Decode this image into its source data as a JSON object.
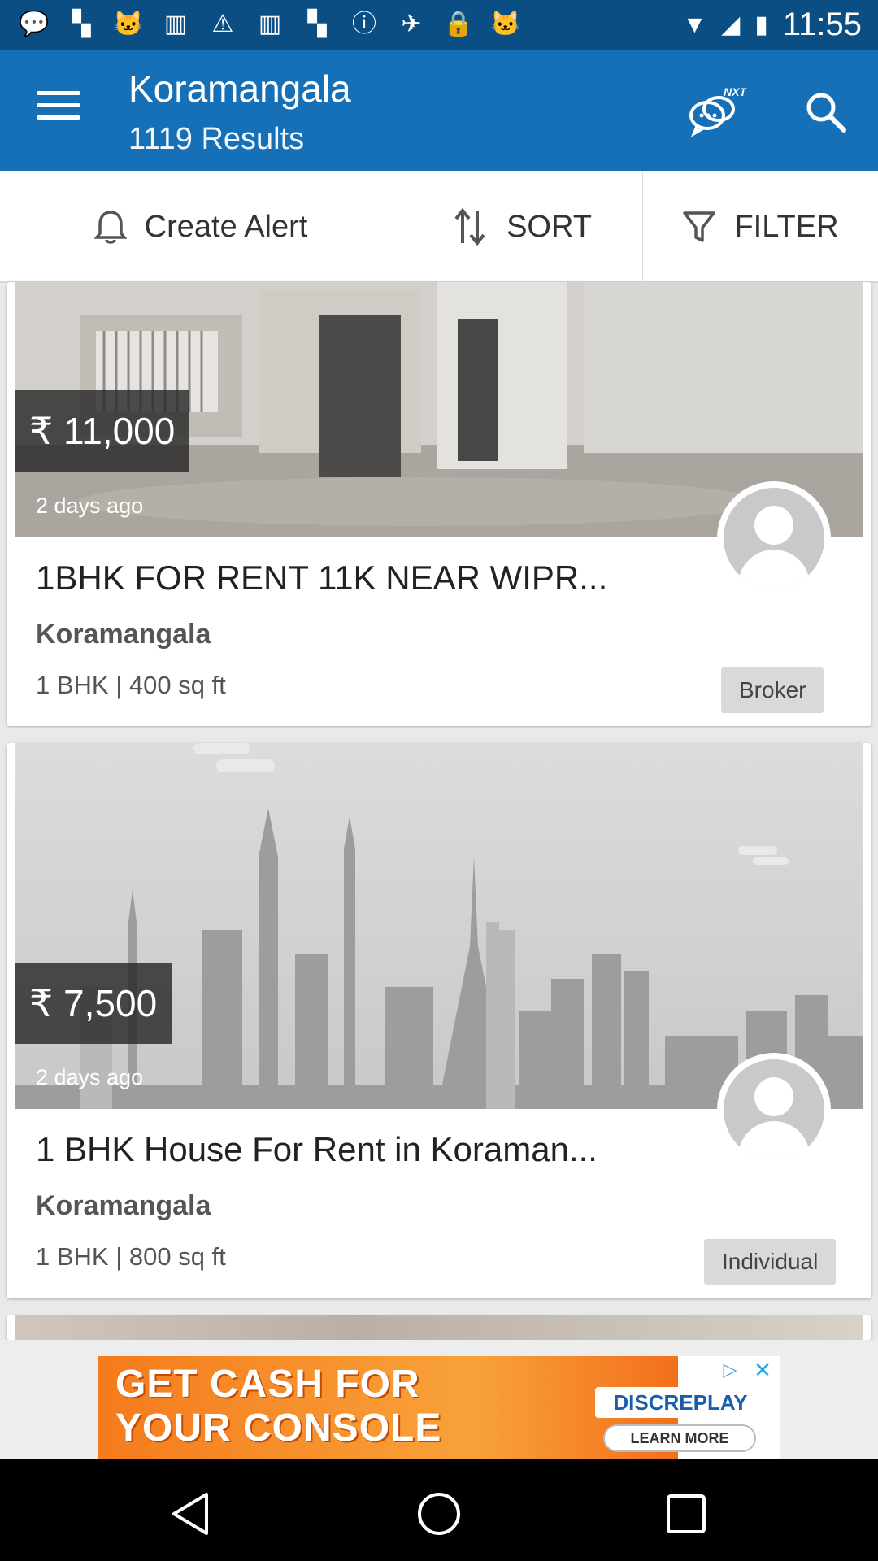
{
  "status_bar": {
    "time": "11:55",
    "icons": [
      "chat-bubble-icon",
      "flipboard-icon",
      "cat-icon",
      "bookmark-icon",
      "warning-icon",
      "bookmark-icon",
      "flipboard-icon",
      "info-icon",
      "fake-gps-icon",
      "lock-icon",
      "cat-icon"
    ]
  },
  "app_bar": {
    "title": "Koramangala",
    "subtitle": "1119 Results",
    "chat_badge": "NXT"
  },
  "actions": {
    "create_alert": "Create Alert",
    "sort": "SORT",
    "filter": "FILTER"
  },
  "listings": [
    {
      "price": "₹ 11,000",
      "posted": "2 days ago",
      "title": "1BHK FOR RENT 11K NEAR WIPR...",
      "locality": "Koramangala",
      "specs": "1 BHK | 400 sq ft",
      "badge": "Broker"
    },
    {
      "price": "₹ 7,500",
      "posted": "2 days ago",
      "title": "1 BHK House For Rent in Koraman...",
      "locality": "Koramangala",
      "specs": "1 BHK | 800 sq ft",
      "badge": "Individual"
    }
  ],
  "ad": {
    "line1": "GET CASH FOR",
    "line2": "YOUR CONSOLE",
    "brand": "DISCREPLAY",
    "cta": "LEARN MORE"
  },
  "colors": {
    "status_bar": "#0b4e83",
    "app_bar": "#1670b8",
    "ad_orange": "#f57b1d"
  }
}
